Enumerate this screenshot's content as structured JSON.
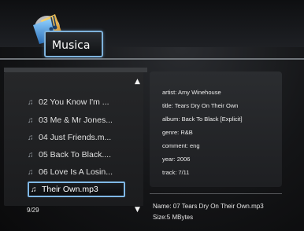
{
  "header": {
    "title": "Musica",
    "icon": "music-folder-icon"
  },
  "playlist": {
    "items": [
      {
        "label": "02 You Know I'm ...",
        "icon": "music-note-icon"
      },
      {
        "label": "03 Me & Mr Jones...",
        "icon": "music-note-icon"
      },
      {
        "label": "04 Just Friends.m...",
        "icon": "music-note-icon"
      },
      {
        "label": "05 Back To Black....",
        "icon": "music-note-icon"
      },
      {
        "label": "06 Love Is A Losin...",
        "icon": "music-note-icon"
      },
      {
        "label": "Their Own.mp3",
        "icon": "music-note-icon",
        "selected": true
      }
    ],
    "counter": "9/29",
    "scroll_up": "▲",
    "scroll_down": "▼"
  },
  "track_info": {
    "artist": "artist: Amy Winehouse",
    "title": "title: Tears Dry On Their Own",
    "album": "album: Back To Black [Explicit]",
    "genre": "genre: R&B",
    "comment": "comment: eng",
    "year": "year: 2006",
    "track": "track: 7/11"
  },
  "file": {
    "name": "Name: 07 Tears Dry On Their Own.mp3",
    "size": "Size:5 MBytes"
  },
  "colors": {
    "highlight_border": "#7fb8e6",
    "panel": "#262729",
    "background": "#0a0a0b"
  }
}
